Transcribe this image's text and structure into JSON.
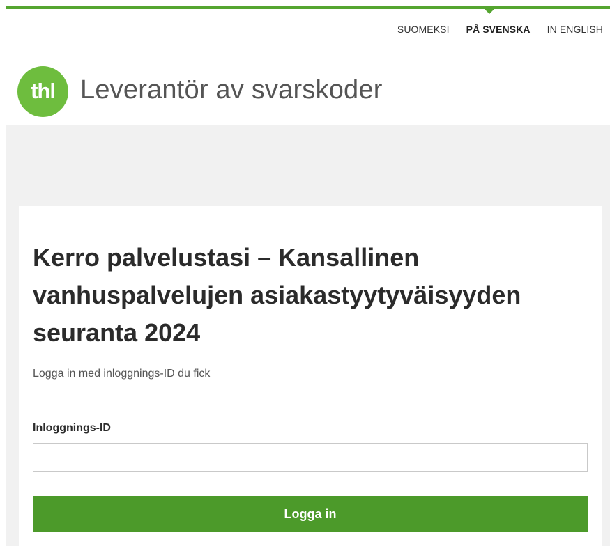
{
  "colors": {
    "brand_green": "#55a530",
    "logo_green": "#6ebd3e",
    "button_green": "#4c9a2a",
    "background_gray": "#f1f1f1"
  },
  "language_nav": {
    "items": [
      {
        "label": "SUOMEKSI",
        "active": false
      },
      {
        "label": "PÅ SVENSKA",
        "active": true
      },
      {
        "label": "IN ENGLISH",
        "active": false
      }
    ]
  },
  "header": {
    "logo_text": "thl",
    "site_title": "Leverantör av svarskoder"
  },
  "login_card": {
    "title": "Kerro palvelustasi – Kansallinen vanhuspalvelujen asiakastyytyväisyyden seuranta 2024",
    "subtitle": "Logga in med inloggnings-ID du fick",
    "field_label": "Inloggnings-ID",
    "field_value": "",
    "button_label": "Logga in"
  }
}
